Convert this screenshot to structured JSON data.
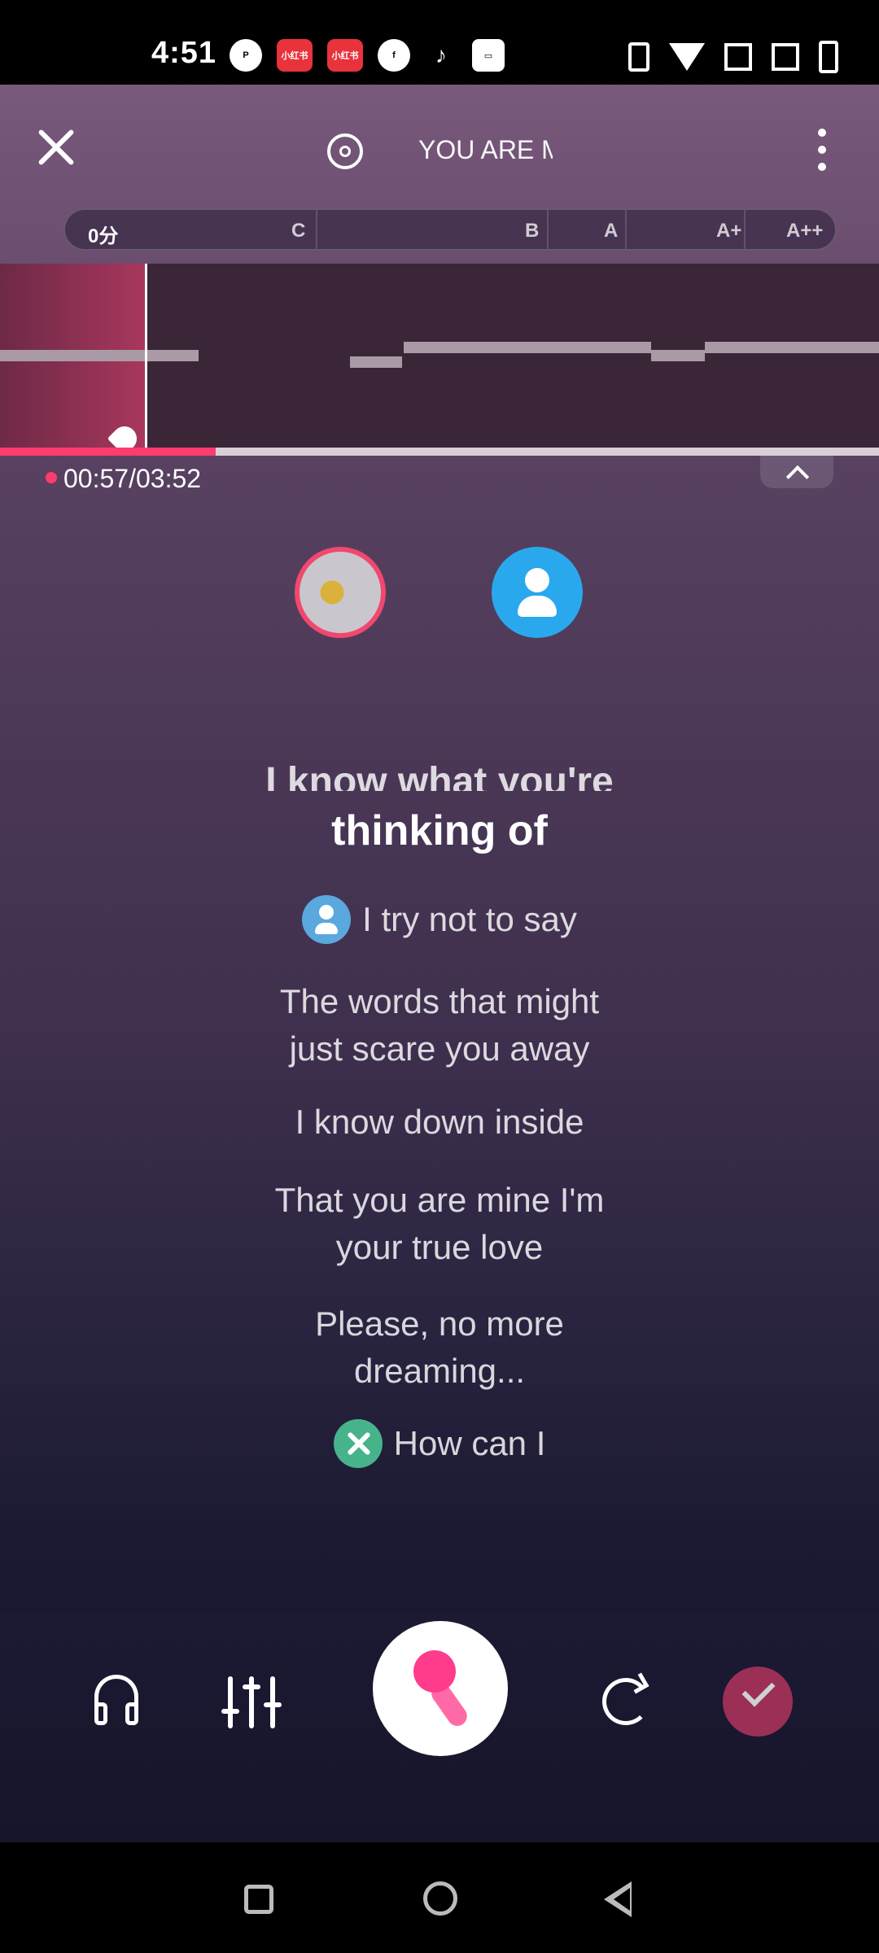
{
  "status_bar": {
    "time": "4:51",
    "icons": [
      "p-app-icon",
      "xiaohongshu-icon",
      "xiaohongshu-icon",
      "facebook-icon",
      "tiktok-icon",
      "inbox-icon"
    ],
    "red_label": "小红书"
  },
  "header": {
    "song_title": "YOU ARE M"
  },
  "score": {
    "current": "0分",
    "grades": [
      "C",
      "B",
      "A",
      "A+",
      "A++"
    ]
  },
  "playback": {
    "time": "00:57/03:52",
    "progress_fraction": 0.245
  },
  "lyrics": {
    "cut_line": "I know what you're",
    "current_line": "thinking of",
    "lines": [
      {
        "text": "I try not to say",
        "singer": "blue-user"
      },
      {
        "text": "The words that might",
        "singer": ""
      },
      {
        "text": "just scare you away",
        "singer": ""
      },
      {
        "text": "I know down inside",
        "singer": ""
      },
      {
        "text": "That you are mine I'm",
        "singer": ""
      },
      {
        "text": "your true love",
        "singer": ""
      },
      {
        "text": "Please, no more",
        "singer": ""
      },
      {
        "text": "dreaming...",
        "singer": ""
      },
      {
        "text": "How can I",
        "singer": "duet"
      }
    ]
  },
  "colors": {
    "accent": "#ff3c6e",
    "avatar_blue": "#2aa8ee",
    "finish": "#9c2f56"
  }
}
